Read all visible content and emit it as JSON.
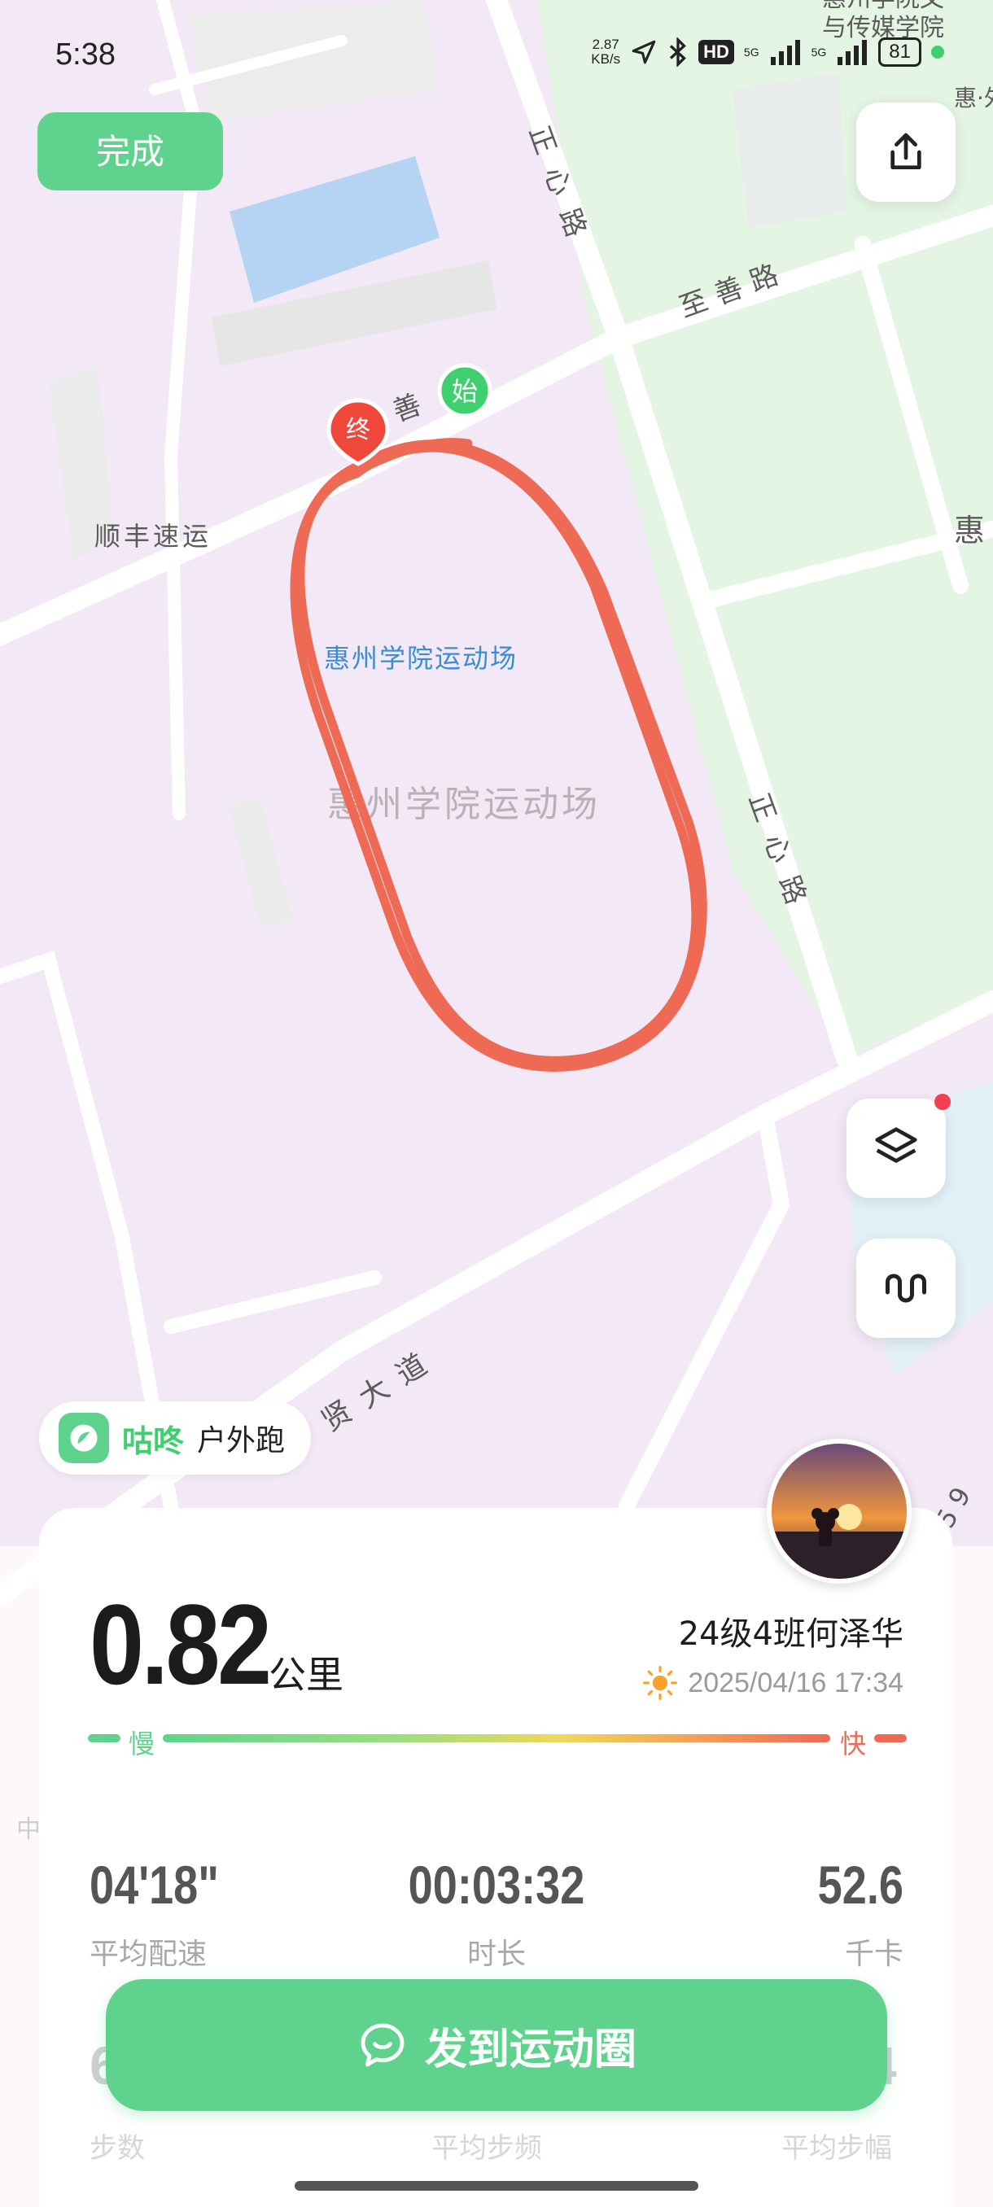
{
  "status_bar": {
    "time": "5:38",
    "net_speed_value": "2.87",
    "net_speed_unit": "KB/s",
    "hd_label": "HD",
    "sig1_label": "5G",
    "sig2_label": "5G",
    "battery": "81"
  },
  "toolbar": {
    "done_label": "完成"
  },
  "map": {
    "labels": {
      "road_zhengxin_top": "正心路",
      "road_zhishan": "至善路",
      "road_shan": "善",
      "shunfeng": "顺丰速运",
      "stadium_label": "惠州学院运动场",
      "stadium_watermark": "惠州学院运动场",
      "road_zhengxin_mid": "正心路",
      "road_xian": "贤大道",
      "edge_hui_right": "惠",
      "edge_media_1": "惠州学院文",
      "edge_media_2": "与传媒学院",
      "edge_hui_wai": "惠·外",
      "edge_zhong": "中",
      "edge_num": "5 9"
    },
    "start_marker": "始",
    "end_marker": "终"
  },
  "brand": {
    "name": "咕咚",
    "activity_type": "户外跑"
  },
  "summary": {
    "distance": "0.82",
    "distance_unit": "公里",
    "user_name": "24级4班何泽华",
    "datetime": "2025/04/16 17:34",
    "speed_slow_label": "慢",
    "speed_fast_label": "快"
  },
  "metrics": [
    {
      "value": "04'18\"",
      "label": "平均配速"
    },
    {
      "value": "00:03:32",
      "label": "时长"
    },
    {
      "value": "52.6",
      "label": "千卡"
    }
  ],
  "metrics_second_row": [
    {
      "value": "6",
      "label": "步数"
    },
    {
      "value": "",
      "label": "平均步频"
    },
    {
      "value": "4",
      "label": "平均步幅"
    }
  ],
  "share_button_label": "发到运动圈",
  "colors": {
    "accent": "#5fd38d",
    "route": "#ee6a55",
    "map_bg": "#f3e8f5",
    "park": "#e5f5e4"
  }
}
